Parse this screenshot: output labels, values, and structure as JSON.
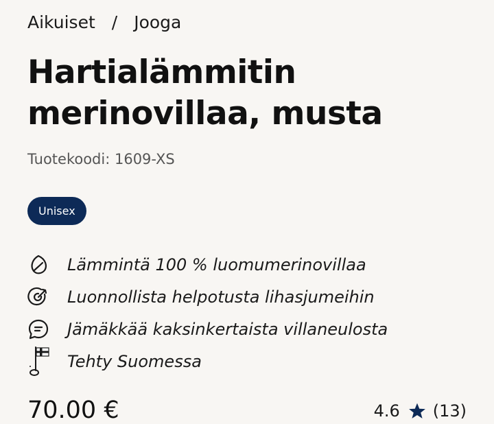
{
  "breadcrumb": {
    "items": [
      "Aikuiset",
      "Jooga"
    ],
    "separator": "/"
  },
  "product": {
    "title": "Hartialämmitin merinovillaa, musta",
    "sku": "Tuotekoodi: 1609-XS",
    "badge": "Unisex",
    "price": "70.00 €"
  },
  "features": [
    {
      "icon": "leaf-icon",
      "text": "Lämmintä 100 % luomumerinovillaa"
    },
    {
      "icon": "target-icon",
      "text": "Luonnollista helpotusta lihasjumeihin"
    },
    {
      "icon": "chat-bubble-icon",
      "text": "Jämäkkää kaksinkertaista villaneulosta"
    },
    {
      "icon": "finnish-flag-icon",
      "text": "Tehty Suomessa"
    }
  ],
  "rating": {
    "score": "4.6",
    "count": "(13)"
  },
  "colors": {
    "background": "#f8f6f3",
    "badge": "#0d2a57",
    "star": "#0d2a57",
    "text": "#1a1a1a"
  }
}
